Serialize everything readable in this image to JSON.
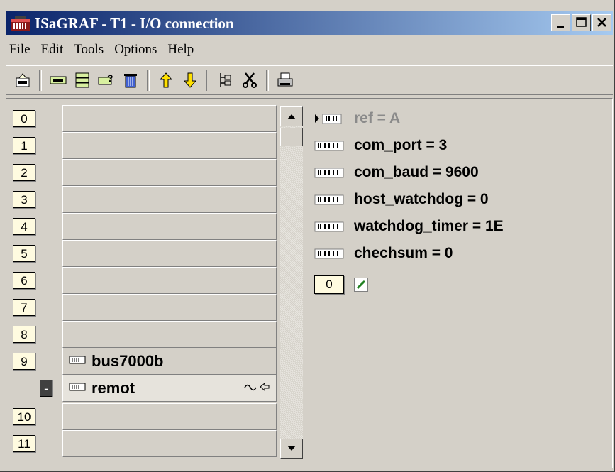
{
  "window": {
    "title": "ISaGRAF - T1 - I/O connection"
  },
  "menu": [
    "File",
    "Edit",
    "Tools",
    "Options",
    "Help"
  ],
  "slots": [
    {
      "num": "0",
      "board": ""
    },
    {
      "num": "1",
      "board": ""
    },
    {
      "num": "2",
      "board": ""
    },
    {
      "num": "3",
      "board": ""
    },
    {
      "num": "4",
      "board": ""
    },
    {
      "num": "5",
      "board": ""
    },
    {
      "num": "6",
      "board": ""
    },
    {
      "num": "7",
      "board": ""
    },
    {
      "num": "8",
      "board": ""
    },
    {
      "num": "9",
      "board": "bus7000b"
    },
    {
      "num": "-",
      "board": "remot"
    },
    {
      "num": "10",
      "board": ""
    },
    {
      "num": "11",
      "board": ""
    }
  ],
  "params": [
    {
      "text": "ref = A",
      "disabled": true
    },
    {
      "text": "com_port = 3",
      "disabled": false
    },
    {
      "text": "com_baud = 9600",
      "disabled": false
    },
    {
      "text": "host_watchdog = 0",
      "disabled": false
    },
    {
      "text": "watchdog_timer = 1E",
      "disabled": false
    },
    {
      "text": "chechsum = 0",
      "disabled": false
    }
  ],
  "channel": {
    "num": "0"
  }
}
